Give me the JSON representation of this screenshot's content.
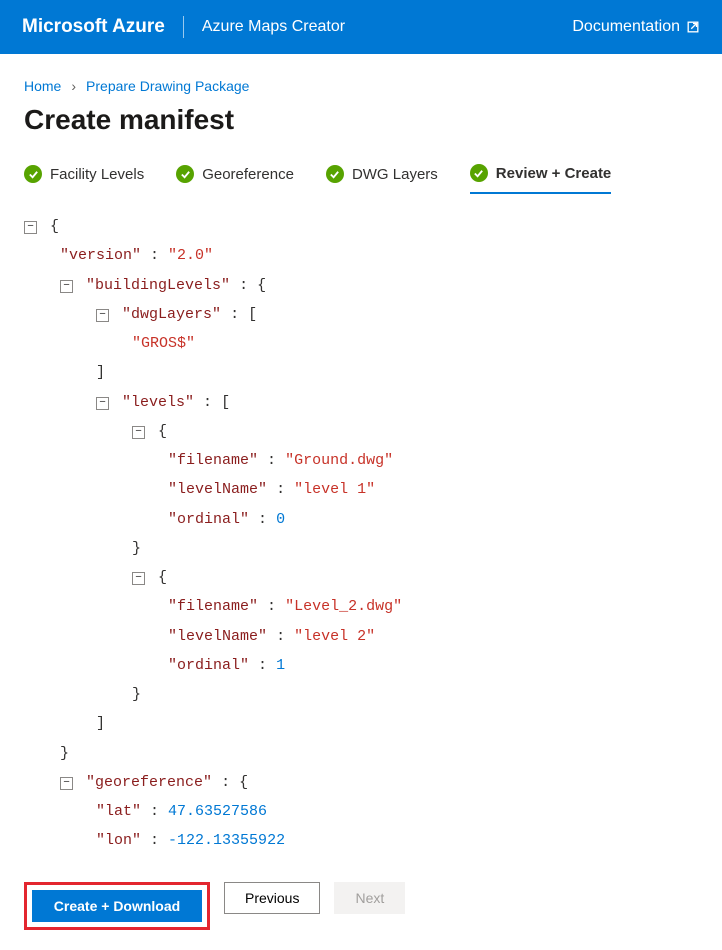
{
  "topbar": {
    "brand": "Microsoft Azure",
    "product": "Azure Maps Creator",
    "doc_label": "Documentation"
  },
  "breadcrumb": {
    "home": "Home",
    "sep": "›",
    "current": "Prepare Drawing Package"
  },
  "page_title": "Create manifest",
  "steps": [
    {
      "label": "Facility Levels",
      "active": false
    },
    {
      "label": "Georeference",
      "active": false
    },
    {
      "label": "DWG Layers",
      "active": false
    },
    {
      "label": "Review + Create",
      "active": true
    }
  ],
  "json": {
    "lines": [
      {
        "pad": 0,
        "toggle": true,
        "segs": [
          {
            "t": "punc",
            "v": "{"
          }
        ]
      },
      {
        "pad": 2,
        "toggle": false,
        "segs": [
          {
            "t": "key",
            "v": "\"version\""
          },
          {
            "t": "colon",
            "v": " : "
          },
          {
            "t": "str",
            "v": "\"2.0\""
          }
        ]
      },
      {
        "pad": 2,
        "toggle": true,
        "segs": [
          {
            "t": "key",
            "v": "\"buildingLevels\""
          },
          {
            "t": "colon",
            "v": " : "
          },
          {
            "t": "punc",
            "v": "{"
          }
        ]
      },
      {
        "pad": 4,
        "toggle": true,
        "segs": [
          {
            "t": "key",
            "v": "\"dwgLayers\""
          },
          {
            "t": "colon",
            "v": " : "
          },
          {
            "t": "punc",
            "v": "["
          }
        ]
      },
      {
        "pad": 6,
        "toggle": false,
        "segs": [
          {
            "t": "str",
            "v": "\"GROS$\""
          }
        ]
      },
      {
        "pad": 4,
        "toggle": false,
        "segs": [
          {
            "t": "punc",
            "v": "]"
          }
        ]
      },
      {
        "pad": 4,
        "toggle": true,
        "segs": [
          {
            "t": "key",
            "v": "\"levels\""
          },
          {
            "t": "colon",
            "v": " : "
          },
          {
            "t": "punc",
            "v": "["
          }
        ]
      },
      {
        "pad": 6,
        "toggle": true,
        "segs": [
          {
            "t": "punc",
            "v": "{"
          }
        ]
      },
      {
        "pad": 8,
        "toggle": false,
        "segs": [
          {
            "t": "key",
            "v": "\"filename\""
          },
          {
            "t": "colon",
            "v": " : "
          },
          {
            "t": "str",
            "v": "\"Ground.dwg\""
          }
        ]
      },
      {
        "pad": 8,
        "toggle": false,
        "segs": [
          {
            "t": "key",
            "v": "\"levelName\""
          },
          {
            "t": "colon",
            "v": " : "
          },
          {
            "t": "str",
            "v": "\"level 1\""
          }
        ]
      },
      {
        "pad": 8,
        "toggle": false,
        "segs": [
          {
            "t": "key",
            "v": "\"ordinal\""
          },
          {
            "t": "colon",
            "v": " : "
          },
          {
            "t": "num",
            "v": "0"
          }
        ]
      },
      {
        "pad": 6,
        "toggle": false,
        "segs": [
          {
            "t": "punc",
            "v": "}"
          }
        ]
      },
      {
        "pad": 6,
        "toggle": true,
        "segs": [
          {
            "t": "punc",
            "v": "{"
          }
        ]
      },
      {
        "pad": 8,
        "toggle": false,
        "segs": [
          {
            "t": "key",
            "v": "\"filename\""
          },
          {
            "t": "colon",
            "v": " : "
          },
          {
            "t": "str",
            "v": "\"Level_2.dwg\""
          }
        ]
      },
      {
        "pad": 8,
        "toggle": false,
        "segs": [
          {
            "t": "key",
            "v": "\"levelName\""
          },
          {
            "t": "colon",
            "v": " : "
          },
          {
            "t": "str",
            "v": "\"level 2\""
          }
        ]
      },
      {
        "pad": 8,
        "toggle": false,
        "segs": [
          {
            "t": "key",
            "v": "\"ordinal\""
          },
          {
            "t": "colon",
            "v": " : "
          },
          {
            "t": "num",
            "v": "1"
          }
        ]
      },
      {
        "pad": 6,
        "toggle": false,
        "segs": [
          {
            "t": "punc",
            "v": "}"
          }
        ]
      },
      {
        "pad": 4,
        "toggle": false,
        "segs": [
          {
            "t": "punc",
            "v": "]"
          }
        ]
      },
      {
        "pad": 2,
        "toggle": false,
        "segs": [
          {
            "t": "punc",
            "v": "}"
          }
        ]
      },
      {
        "pad": 2,
        "toggle": true,
        "segs": [
          {
            "t": "key",
            "v": "\"georeference\""
          },
          {
            "t": "colon",
            "v": " : "
          },
          {
            "t": "punc",
            "v": "{"
          }
        ]
      },
      {
        "pad": 4,
        "toggle": false,
        "segs": [
          {
            "t": "key",
            "v": "\"lat\""
          },
          {
            "t": "colon",
            "v": " : "
          },
          {
            "t": "num",
            "v": "47.63527586"
          }
        ]
      },
      {
        "pad": 4,
        "toggle": false,
        "segs": [
          {
            "t": "key",
            "v": "\"lon\""
          },
          {
            "t": "colon",
            "v": " : "
          },
          {
            "t": "num",
            "v": "-122.13355922"
          }
        ]
      }
    ]
  },
  "buttons": {
    "create": "Create + Download",
    "previous": "Previous",
    "next": "Next"
  }
}
